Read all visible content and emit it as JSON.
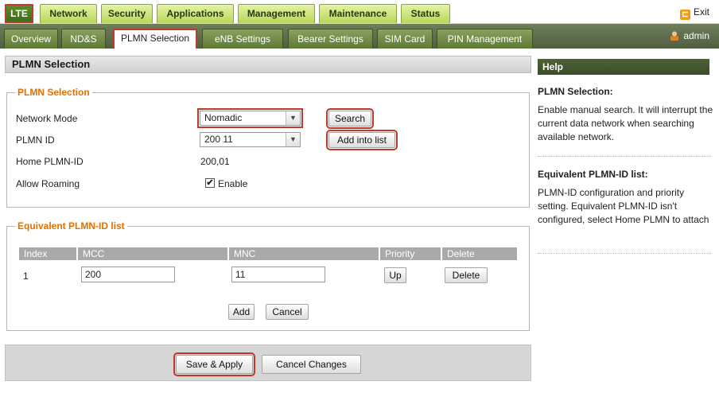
{
  "top_tabs": [
    "LTE",
    "Network",
    "Security",
    "Applications",
    "Management",
    "Maintenance",
    "Status"
  ],
  "exit_label": "Exit",
  "sub_tabs": [
    "Overview",
    "ND&S",
    "PLMN Selection",
    "eNB Settings",
    "Bearer Settings",
    "SIM Card",
    "PIN Management"
  ],
  "user": "admin",
  "page_title": "PLMN Selection",
  "plmn": {
    "legend": "PLMN Selection",
    "network_mode_label": "Network Mode",
    "network_mode_value": "Nomadic",
    "search_button": "Search",
    "plmn_id_label": "PLMN ID",
    "plmn_id_value": "200 11",
    "add_into_list_button": "Add into list",
    "home_plmn_label": "Home PLMN-ID",
    "home_plmn_value": "200,01",
    "allow_roaming_label": "Allow Roaming",
    "enable_label": "Enable",
    "roaming_enabled": true
  },
  "equiv": {
    "legend": "Equivalent PLMN-ID list",
    "headers": [
      "Index",
      "MCC",
      "MNC",
      "Priority",
      "Delete"
    ],
    "rows": [
      {
        "index": "1",
        "mcc": "200",
        "mnc": "11",
        "priority_button": "Up",
        "delete_button": "Delete"
      }
    ],
    "add_button": "Add",
    "cancel_button": "Cancel"
  },
  "footer": {
    "save_apply": "Save & Apply",
    "cancel_changes": "Cancel Changes"
  },
  "help": {
    "header": "Help",
    "sections": [
      {
        "title": "PLMN Selection:",
        "text": "Enable manual search. It will interrupt the current data network when searching available network."
      },
      {
        "title": "Equivalent PLMN-ID list:",
        "text": "PLMN-ID configuration and priority setting. Equivalent PLMN-ID isn't configured, select Home PLMN to attach"
      }
    ]
  },
  "colors": {
    "accent_orange": "#e37000",
    "highlight_red": "#c0392b",
    "nav_green": "#4e5e3f",
    "tab_light_green": "#c9e27a"
  }
}
